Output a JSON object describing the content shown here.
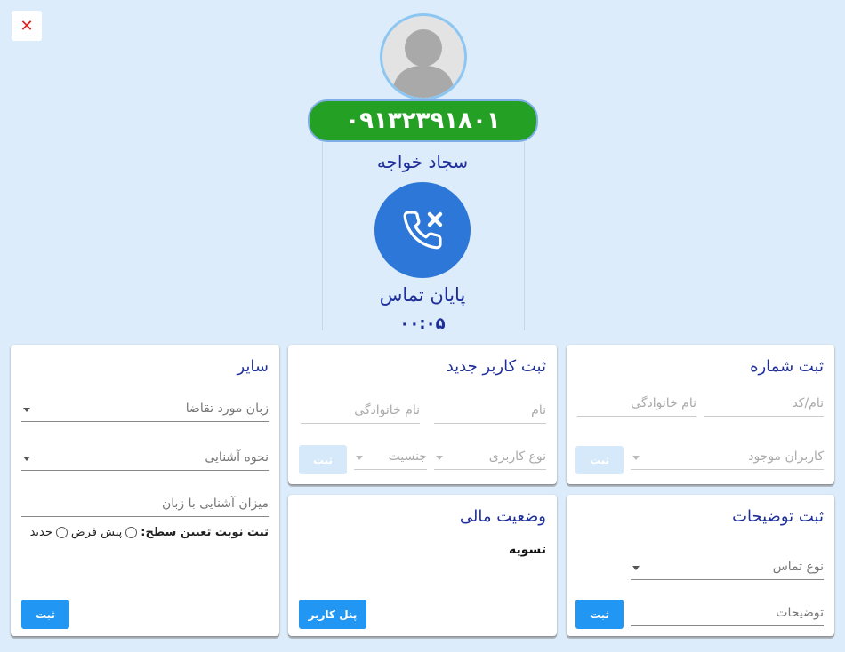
{
  "header": {
    "close_symbol": "✕",
    "phone_number": "۰۹۱۳۲۳۹۱۸۰۱",
    "caller_name": "سجاد خواجه",
    "end_call_label": "پایان تماس",
    "timer": "۰۰:۰۵",
    "colors": {
      "phone_pill": "#24a024",
      "end_call": "#2d77d8",
      "accent_text": "#1e2f9a"
    }
  },
  "register_number": {
    "title": "ثبت شماره",
    "name_code_placeholder": "نام/کد",
    "family_placeholder": "نام خانوادگی",
    "existing_users_placeholder": "کاربران موجود",
    "submit_label": "ثبت"
  },
  "register_user": {
    "title": "ثبت کاربر جدید",
    "name_placeholder": "نام",
    "family_placeholder": "نام خانوادگی",
    "user_type_placeholder": "نوع کاربری",
    "gender_placeholder": "جنسیت",
    "submit_label": "ثبت"
  },
  "other": {
    "title": "سایر",
    "language_placeholder": "زبان مورد تقاضا",
    "acquaintance_placeholder": "نحوه آشنایی",
    "familiarity_placeholder": "میزان آشنایی با زبان",
    "level_label": "ثبت نوبت تعیین سطح:",
    "option_default": "پیش فرض",
    "option_new": "جدید",
    "submit_label": "ثبت"
  },
  "description": {
    "title": "ثبت توضیحات",
    "call_type_placeholder": "نوع تماس",
    "notes_placeholder": "توضیحات",
    "submit_label": "ثبت"
  },
  "finance": {
    "title": "وضعیت مالی",
    "status": "تسویه",
    "panel_button": "پنل کاربر"
  }
}
